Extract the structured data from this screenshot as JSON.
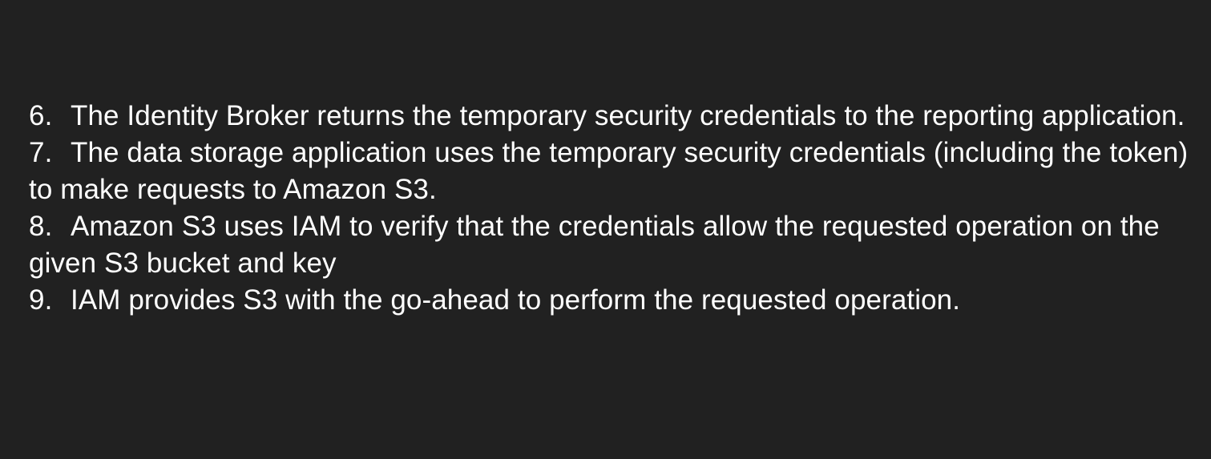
{
  "steps": [
    {
      "number": "6.",
      "text": "The Identity Broker returns the temporary security credentials to the reporting application."
    },
    {
      "number": "7.",
      "text": "The data storage application uses the temporary security credentials (including the token) to make requests to Amazon S3."
    },
    {
      "number": "8.",
      "text": "Amazon S3 uses IAM to verify that the credentials allow the requested operation on the given S3 bucket and key"
    },
    {
      "number": "9.",
      "text": "IAM provides S3 with the go-ahead to perform the requested operation."
    }
  ]
}
